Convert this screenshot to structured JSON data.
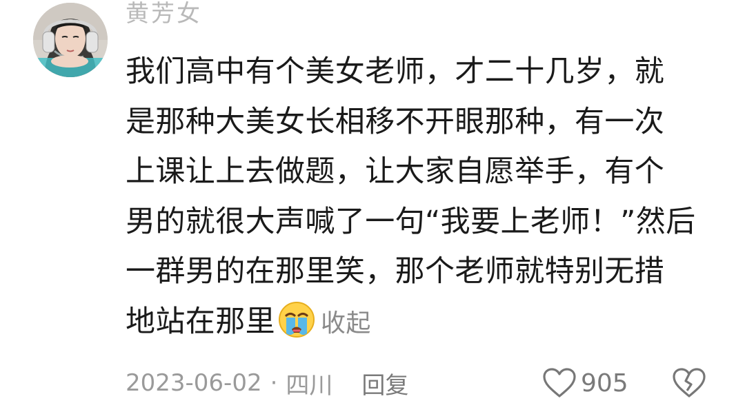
{
  "comment": {
    "username": "黄芳女",
    "text_lines": [
      "我们高中有个美女老师，才二十几岁，就",
      "是那种大美女长相移不开眼那种，有一次",
      "上课让上去做题，让大家自愿举手，有个",
      "男的就很大声喊了一句“我要上老师！”然后",
      "一群男的在那里笑，那个老师就特别无措",
      "地站在那里"
    ],
    "emoji": "crying-face",
    "collapse_label": "收起",
    "date": "2023-06-02",
    "location": "四川",
    "separator": "·",
    "reply_label": "回复",
    "likes": "905"
  },
  "colors": {
    "text": "#1a1a1a",
    "muted": "#9a9a9a",
    "icon": "#7a7a7a",
    "emoji_face": "#ffd24a",
    "emoji_tear": "#4fb6f0"
  },
  "icons": {
    "like": "heart-outline-icon",
    "dislike": "broken-heart-icon"
  }
}
